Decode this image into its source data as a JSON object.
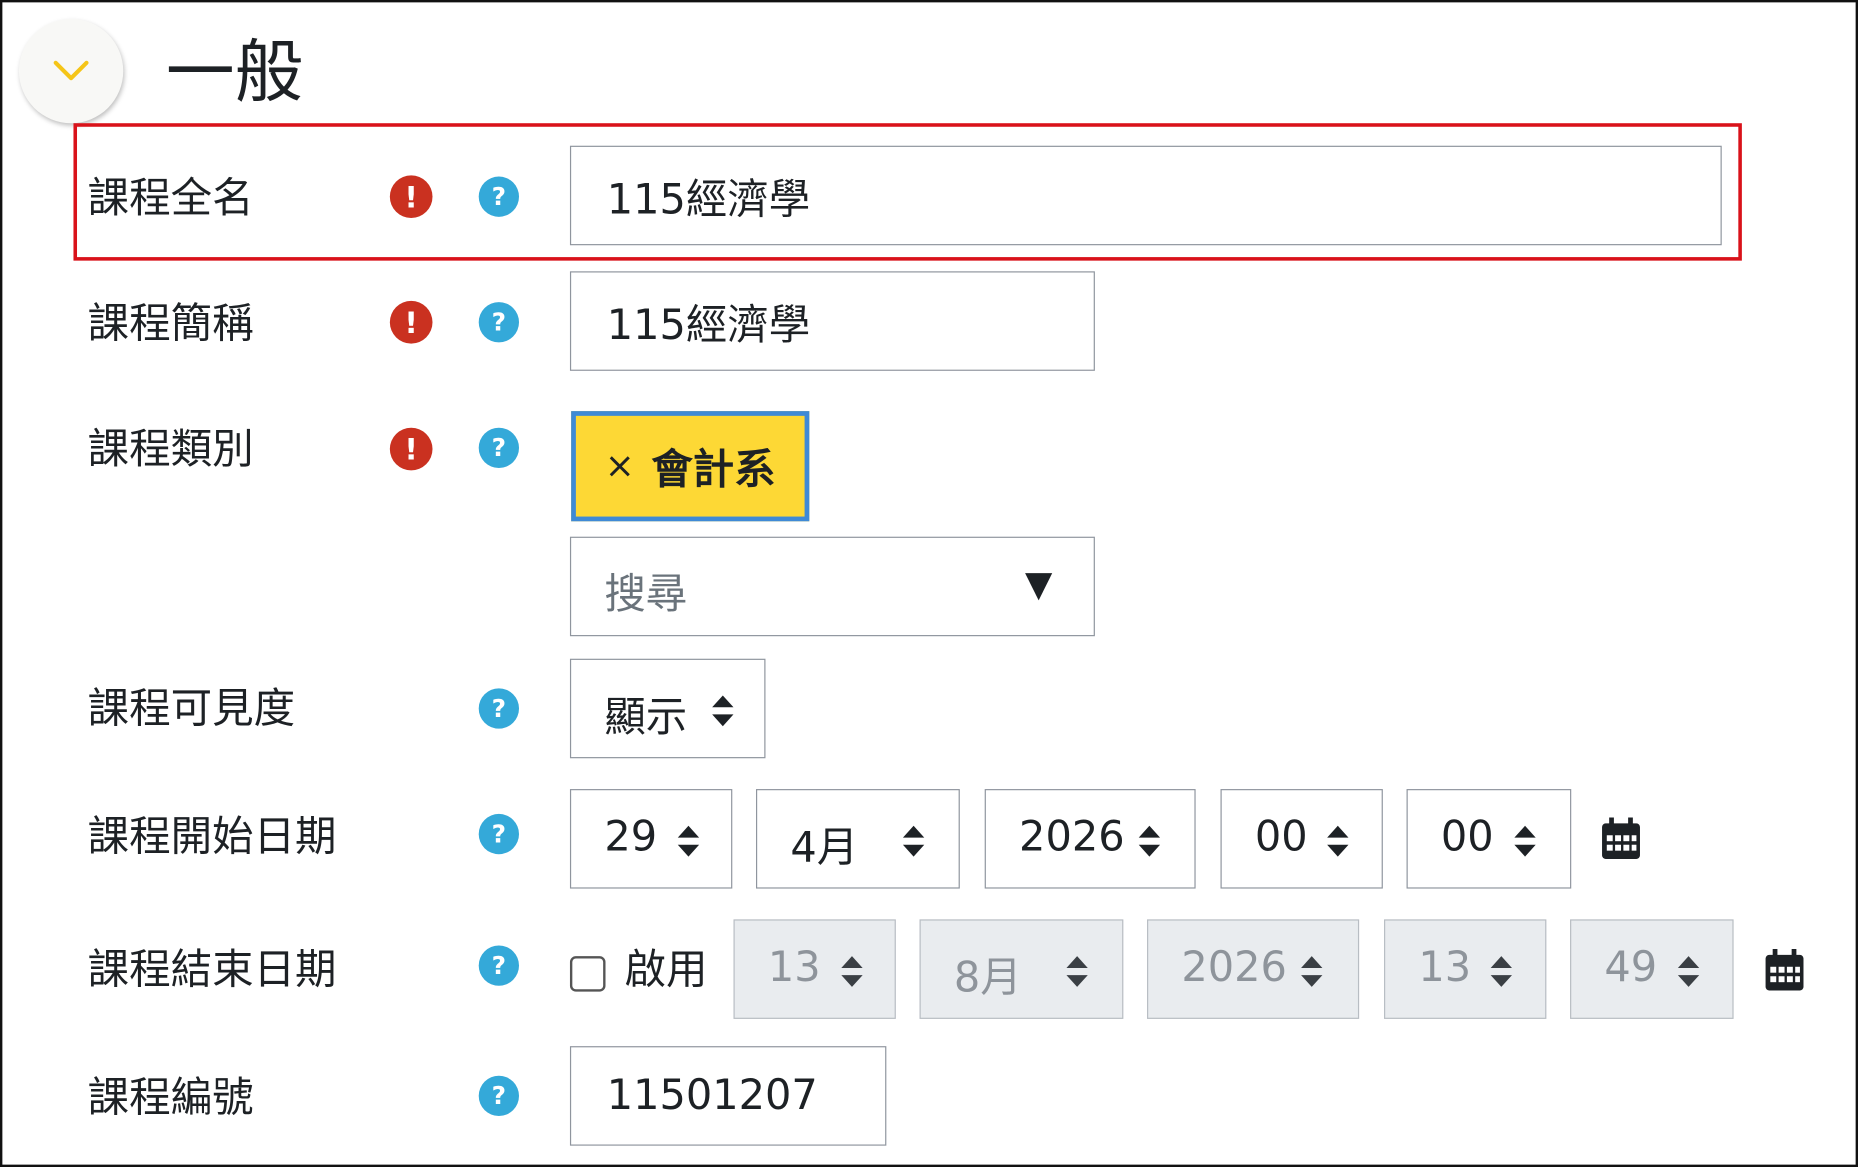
{
  "section": {
    "title": "一般",
    "colors": {
      "collapse_chevron": "#f5c518",
      "required": "#ca3120",
      "help": "#34a9d9",
      "tag_bg": "#fdd835",
      "tag_border": "#3f8ad6",
      "highlight": "#d9121a"
    }
  },
  "fields": {
    "fullname": {
      "label": "課程全名",
      "value": "115經濟學",
      "required": true
    },
    "shortname": {
      "label": "課程簡稱",
      "value": "115經濟學",
      "required": true
    },
    "category": {
      "label": "課程類別",
      "required": true,
      "tag_remove": "×",
      "tag": "會計系",
      "search_placeholder": "搜尋",
      "dropdown_glyph": "▼"
    },
    "visibility": {
      "label": "課程可見度",
      "selected": "顯示"
    },
    "startdate": {
      "label": "課程開始日期",
      "day": "29",
      "month": "4月",
      "year": "2026",
      "hour": "00",
      "minute": "00"
    },
    "enddate": {
      "label": "課程結束日期",
      "enable_label": "啟用",
      "enabled": false,
      "day": "13",
      "month": "8月",
      "year": "2026",
      "hour": "13",
      "minute": "49"
    },
    "idnumber": {
      "label": "課程編號",
      "value": "11501207"
    }
  },
  "icons": {
    "required": "!",
    "help": "?"
  }
}
